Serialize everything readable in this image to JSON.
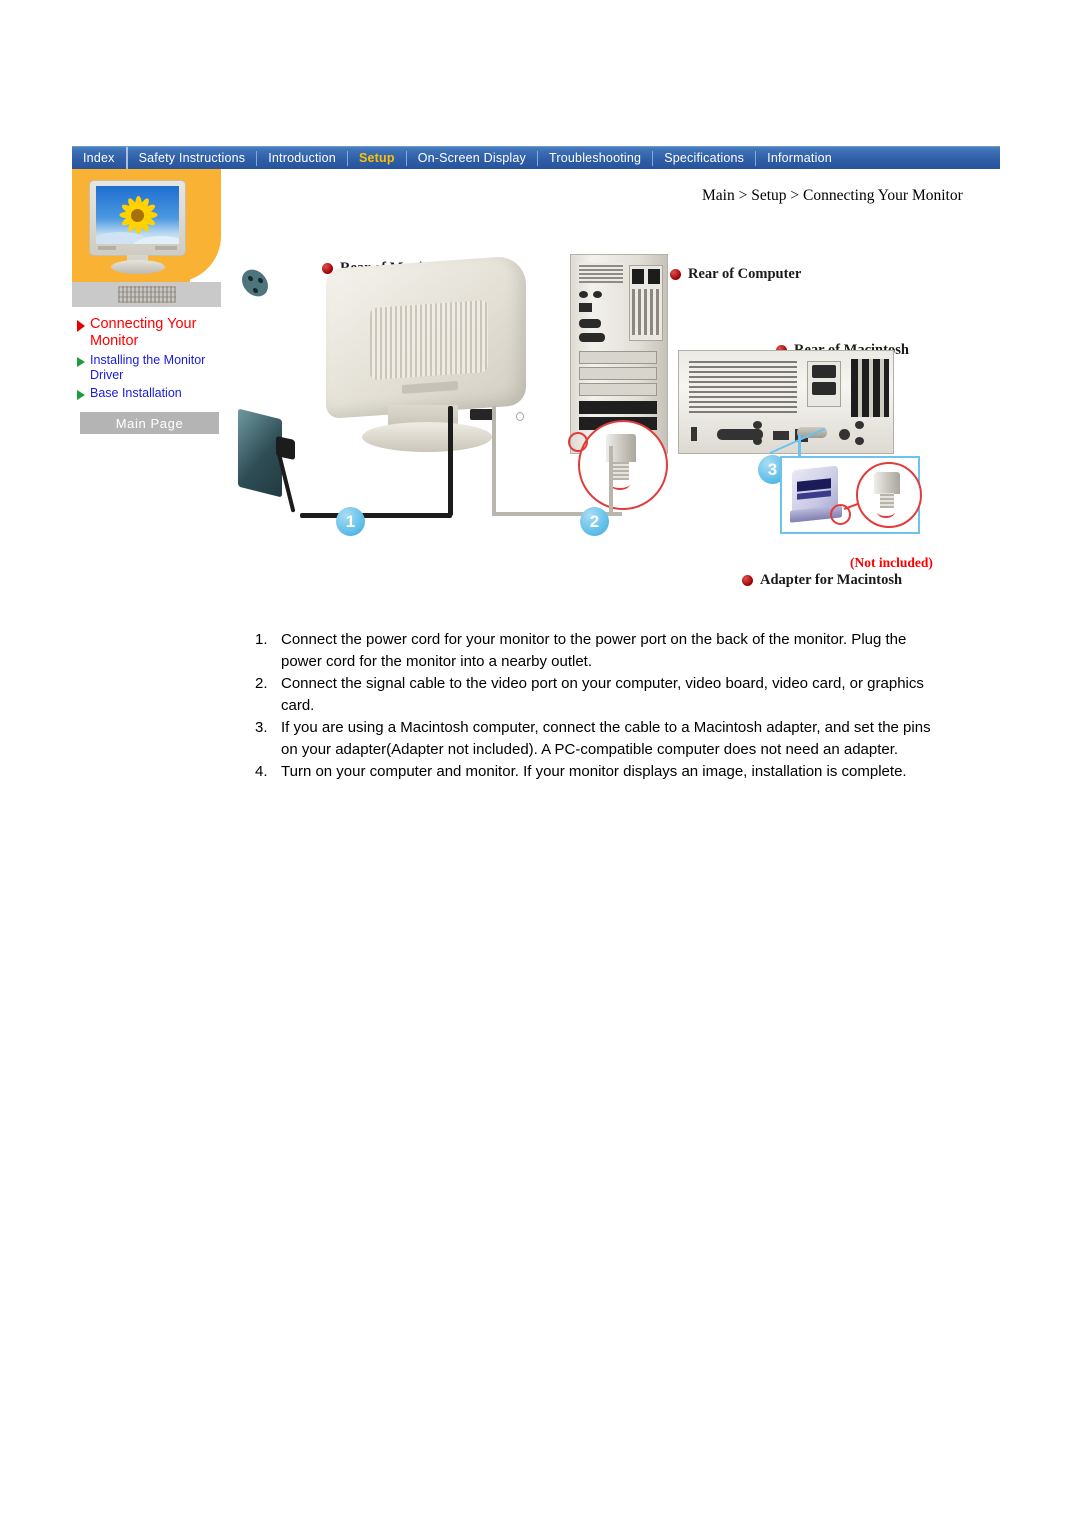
{
  "nav": {
    "items": [
      {
        "label": "Index",
        "active": false
      },
      {
        "label": "Safety Instructions",
        "active": false
      },
      {
        "label": "Introduction",
        "active": false
      },
      {
        "label": "Setup",
        "active": true
      },
      {
        "label": "On-Screen Display",
        "active": false
      },
      {
        "label": "Troubleshooting",
        "active": false
      },
      {
        "label": "Specifications",
        "active": false
      },
      {
        "label": "Information",
        "active": false
      }
    ]
  },
  "sidebar": {
    "links": [
      {
        "label": "Connecting Your Monitor",
        "active": true
      },
      {
        "label": "Installing the Monitor Driver",
        "active": false
      },
      {
        "label": "Base Installation",
        "active": false
      }
    ],
    "main_page_button": "Main Page"
  },
  "breadcrumb": "Main > Setup > Connecting Your Monitor",
  "diagram": {
    "labels": {
      "rear_of_monitor": "Rear of Monitor",
      "rear_of_computer": "Rear of Computer",
      "rear_of_macintosh": "Rear of  Macintosh",
      "adapter_for_macintosh": "Adapter for Macintosh",
      "not_included": "(Not included)"
    },
    "badges": [
      "1",
      "2",
      "3"
    ]
  },
  "instructions": [
    {
      "num": "1.",
      "text": "Connect the power cord for your monitor to the power port on the back of the monitor. Plug the power cord for the monitor into a nearby outlet."
    },
    {
      "num": "2.",
      "text": "Connect the signal cable to the video port on your computer, video board, video card, or graphics card."
    },
    {
      "num": "3.",
      "text": "If you are using a Macintosh computer, connect the cable to a Macintosh adapter, and set the pins on your adapter(Adapter not included). A PC-compatible computer does not need an adapter."
    },
    {
      "num": "4.",
      "text": "Turn on your computer and monitor. If your monitor displays an image, installation is complete."
    }
  ],
  "colors": {
    "nav_blue": "#2f5fa8",
    "active_tab": "#ffc000",
    "sidebar_orange": "#f9b233",
    "active_link_red": "#ff0000",
    "link_blue": "#1b1bdd",
    "badge_blue": "#62bfe8",
    "magnifier_red": "#e23b3b"
  }
}
